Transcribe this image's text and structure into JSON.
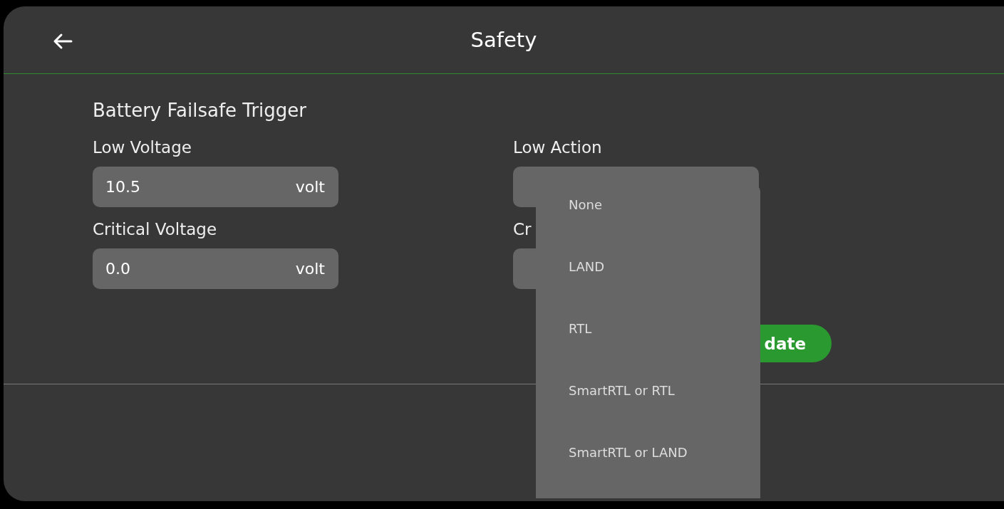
{
  "header": {
    "title": "Safety"
  },
  "section": {
    "title": "Battery Failsafe Trigger"
  },
  "fields": [
    {
      "label": "Low Voltage",
      "value": "10.5",
      "unit": "volt"
    },
    {
      "label": "Critical Voltage",
      "value": "0.0",
      "unit": "volt"
    }
  ],
  "actions": [
    {
      "label": "Low Action"
    },
    {
      "label": "Cr"
    }
  ],
  "update_button": {
    "label": "date"
  },
  "dropdown": {
    "options": [
      "None",
      "LAND",
      "RTL",
      "SmartRTL or RTL",
      "SmartRTL or LAND"
    ]
  }
}
